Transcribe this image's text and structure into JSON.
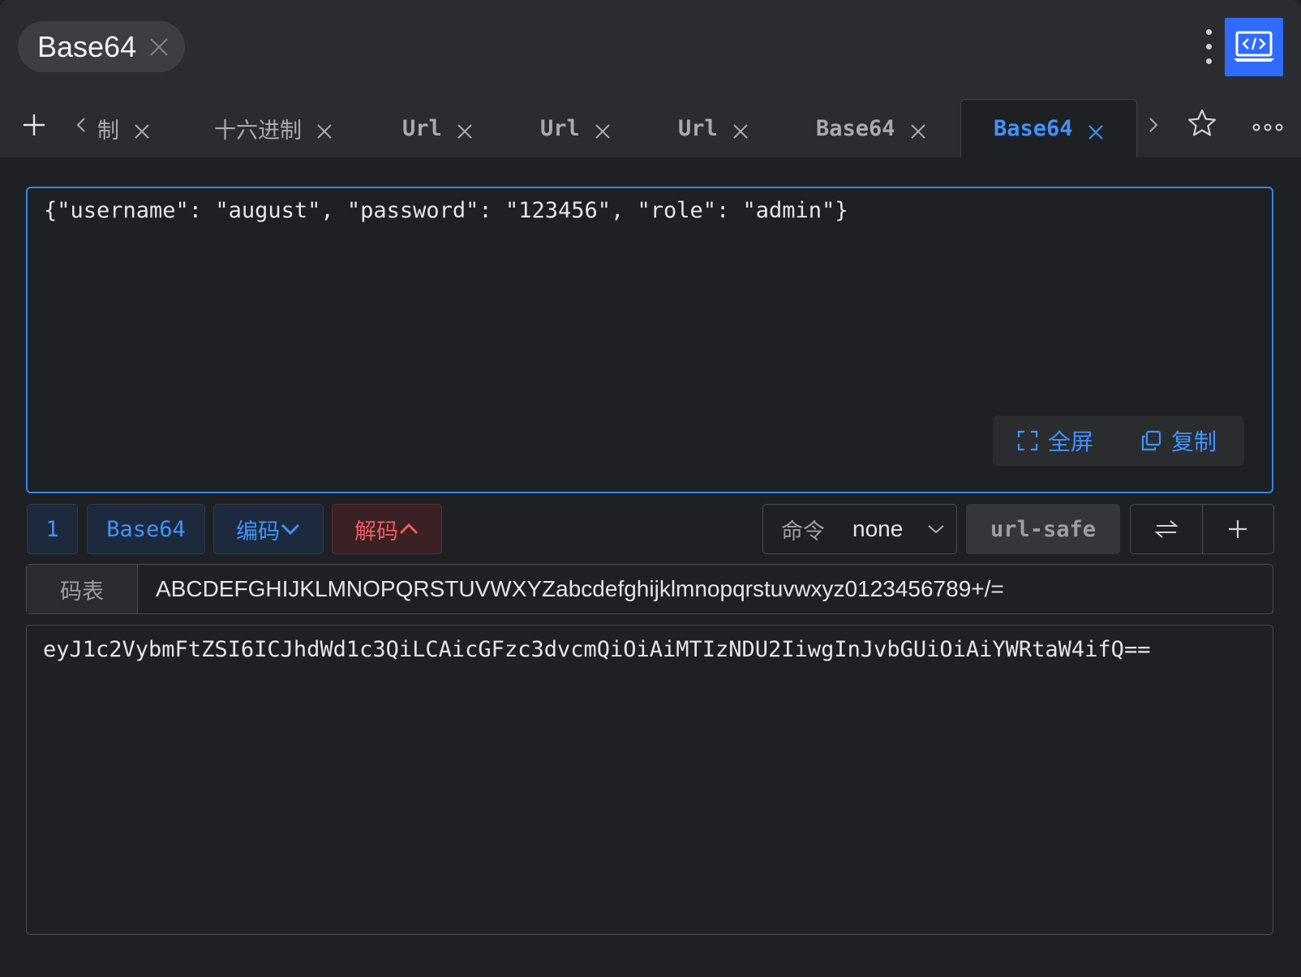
{
  "window": {
    "title": "Base64",
    "accent": "#2f87f0"
  },
  "tabs": [
    {
      "label": "制",
      "active": false
    },
    {
      "label": "十六进制",
      "active": false
    },
    {
      "label": "Url",
      "active": false
    },
    {
      "label": "Url",
      "active": false
    },
    {
      "label": "Url",
      "active": false
    },
    {
      "label": "Base64",
      "active": false
    },
    {
      "label": "Base64",
      "active": true
    }
  ],
  "input": {
    "value": "{\"username\": \"august\", \"password\": \"123456\", \"role\": \"admin\"}",
    "fullscreen_label": "全屏",
    "copy_label": "复制"
  },
  "toolbar": {
    "index": "1",
    "method": "Base64",
    "encode_label": "编码",
    "decode_label": "解码",
    "command_label": "命令",
    "command_value": "none",
    "url_safe_label": "url-safe"
  },
  "charset": {
    "label": "码表",
    "value": "ABCDEFGHIJKLMNOPQRSTUVWXYZabcdefghijklmnopqrstuvwxyz0123456789+/="
  },
  "output": {
    "value": "eyJ1c2VybmFtZSI6ICJhdWd1c3QiLCAicGFzc3dvcmQiOiAiMTIzNDU2IiwgInJvbGUiOiAiYWRtaW4ifQ=="
  },
  "icons": {
    "close": "close-icon",
    "add": "plus-icon",
    "star": "star-icon",
    "more": "more-icon",
    "swap": "swap-icon",
    "app": "code-laptop-icon"
  }
}
